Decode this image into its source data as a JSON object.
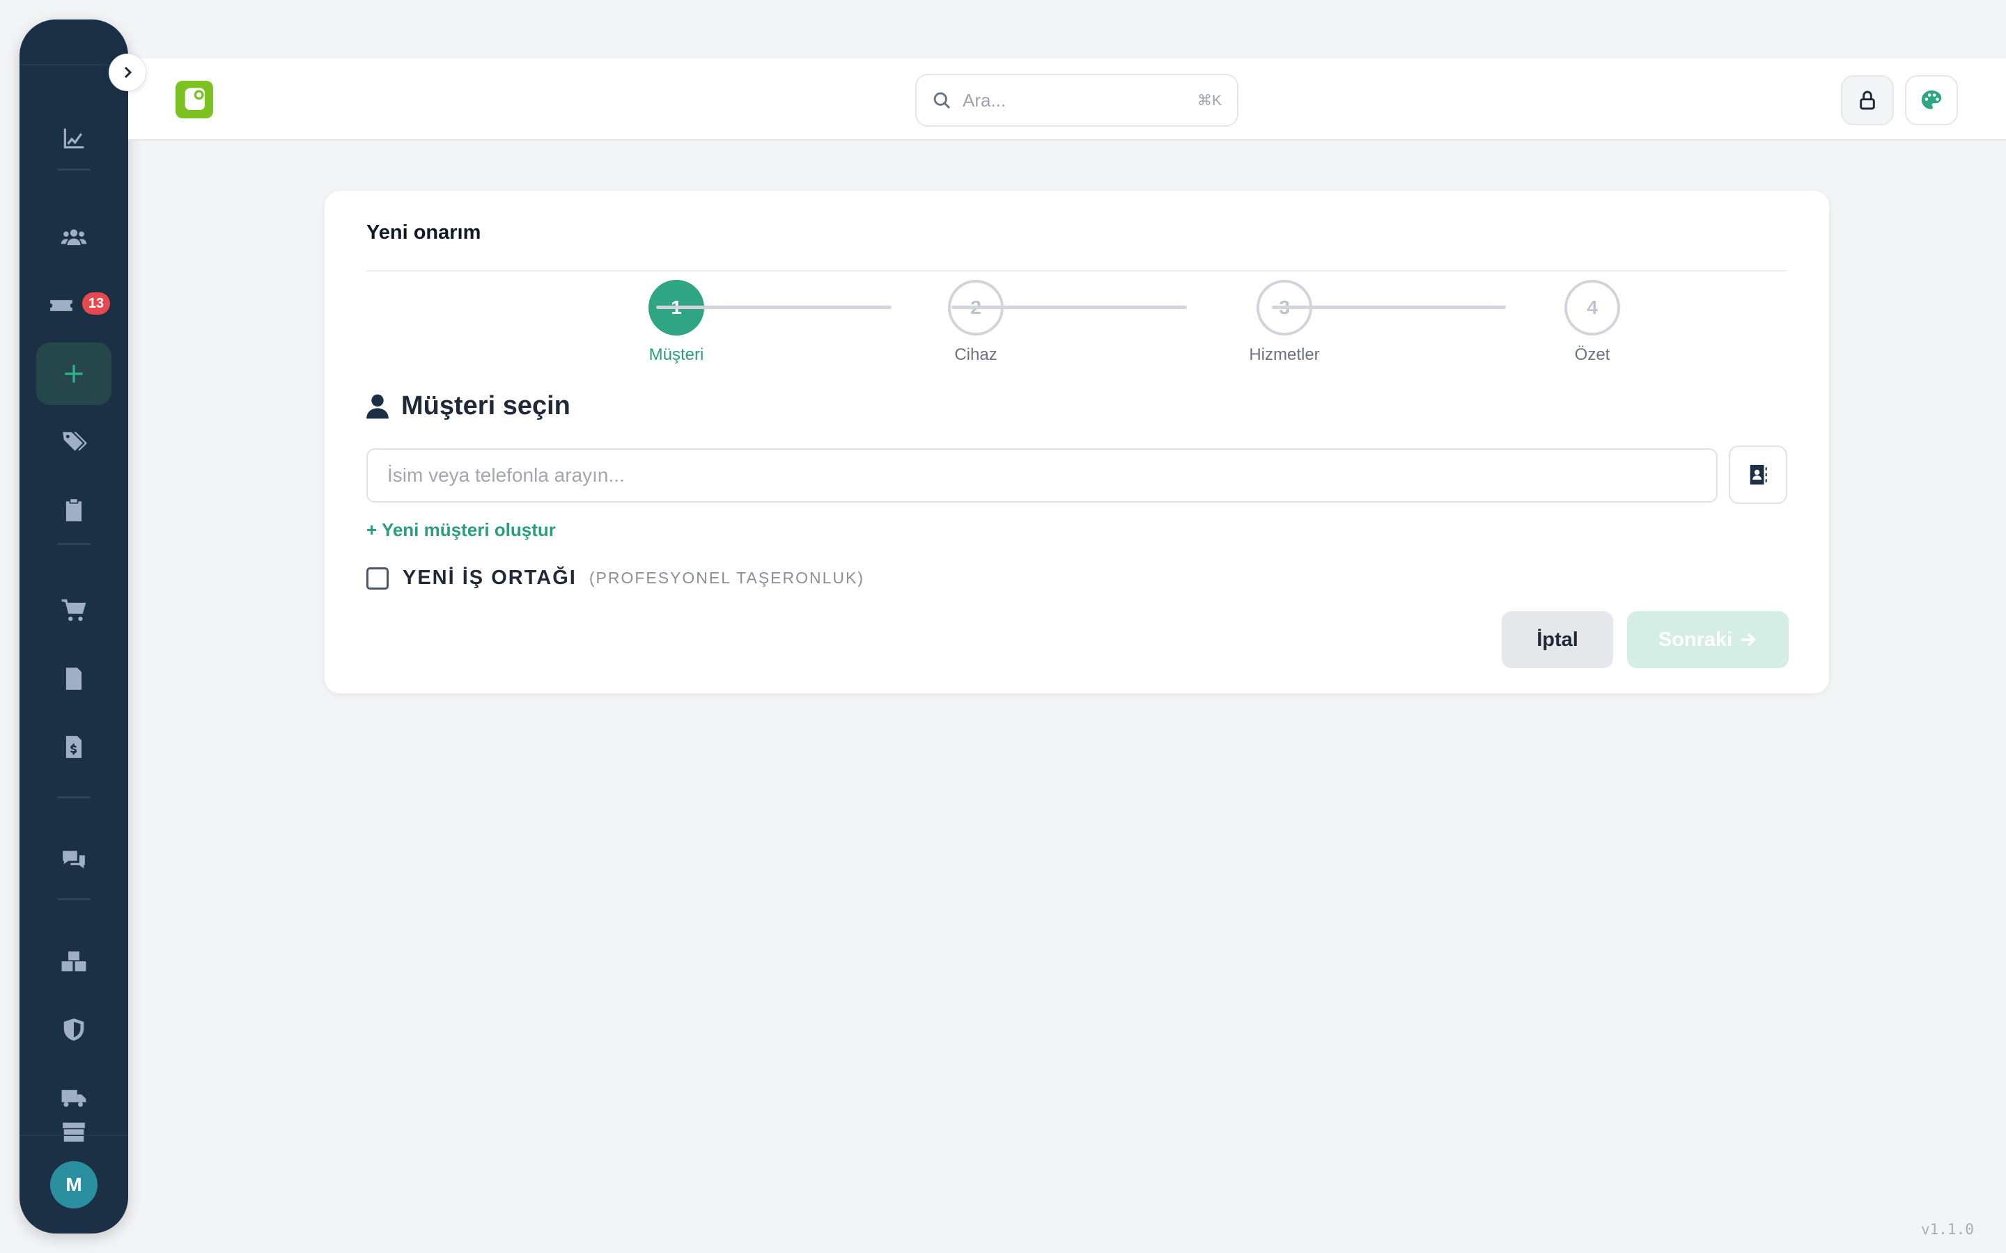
{
  "sidebar": {
    "items": [
      {
        "icon": "chart-line-icon"
      },
      {
        "icon": "users-icon"
      },
      {
        "icon": "ticket-icon",
        "badge": "13"
      },
      {
        "icon": "plus-icon",
        "active": true
      },
      {
        "icon": "tags-icon"
      },
      {
        "icon": "clipboard-list-icon"
      },
      {
        "icon": "cart-icon"
      },
      {
        "icon": "document-icon"
      },
      {
        "icon": "invoice-dollar-icon"
      },
      {
        "icon": "chat-icon"
      },
      {
        "icon": "boxes-icon"
      },
      {
        "icon": "shield-icon"
      },
      {
        "icon": "truck-icon"
      },
      {
        "icon": "archive-icon"
      }
    ],
    "user_initial": "M",
    "active_color": "#2fb38a",
    "badge_color": "#e5484d"
  },
  "header": {
    "search_placeholder": "Ara...",
    "search_shortcut": "⌘K",
    "logo_color": "#7cc322"
  },
  "card": {
    "title": "Yeni onarım",
    "steps": [
      {
        "number": "1",
        "label": "Müşteri",
        "active": true
      },
      {
        "number": "2",
        "label": "Cihaz",
        "active": false
      },
      {
        "number": "3",
        "label": "Hizmetler",
        "active": false
      },
      {
        "number": "4",
        "label": "Özet",
        "active": false
      }
    ],
    "section_title": "Müşteri seçin",
    "customer_search": {
      "placeholder": "İsim veya telefonla arayın...",
      "value": ""
    },
    "new_customer_link": "+ Yeni müşteri oluştur",
    "partner_label": "YENİ İŞ ORTAĞI",
    "partner_sublabel": "(PROFESYONEL TAŞERONLUK)",
    "partner_checked": false,
    "cancel_label": "İptal",
    "next_label": "Sonraki",
    "accent_color": "#2fa584"
  },
  "footer": {
    "version": "v1.1.0"
  }
}
